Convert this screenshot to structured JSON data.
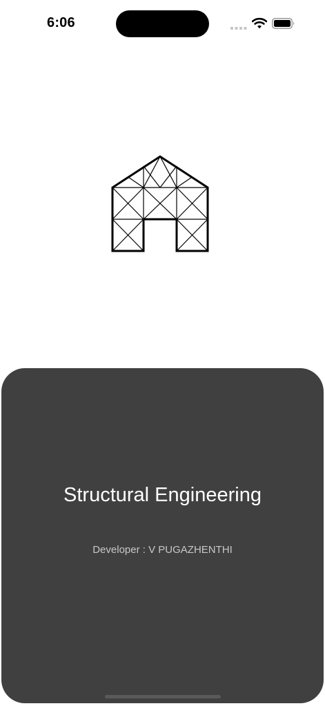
{
  "status_bar": {
    "time": "6:06",
    "icons": [
      "cellular-signal-icon",
      "wifi-icon",
      "battery-icon"
    ]
  },
  "logo": {
    "icon": "truss-house-icon",
    "color": "#000000"
  },
  "bottom_sheet": {
    "title": "Structural Engineering",
    "developer": "Developer : V PUGAZHENTHI",
    "background": "#404040"
  }
}
